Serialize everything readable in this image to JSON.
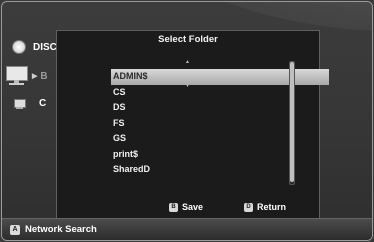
{
  "sidebar": {
    "items": [
      {
        "label": "DISC",
        "icon": "disc-icon"
      },
      {
        "label": "B",
        "icon": "computer-icon"
      },
      {
        "label": "C",
        "icon": "computer-icon"
      }
    ]
  },
  "dialog": {
    "title": "Select Folder",
    "folders": [
      "ADMIN$",
      "CS",
      "DS",
      "FS",
      "GS",
      "print$",
      "SharedD"
    ],
    "selected_index": 0,
    "save_key": "B",
    "save_label": "Save",
    "return_key": "D",
    "return_label": "Return"
  },
  "bottom_bar": {
    "key": "A",
    "label": "Network Search"
  }
}
